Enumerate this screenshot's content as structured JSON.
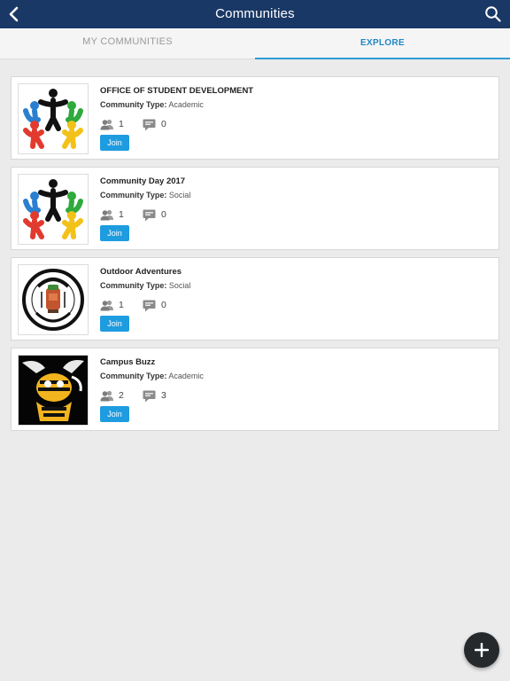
{
  "header": {
    "title": "Communities",
    "back_icon": "chevron-left-icon",
    "search_icon": "search-icon",
    "background": "#1a3866"
  },
  "tabs": [
    {
      "label": "MY COMMUNITIES",
      "active": false
    },
    {
      "label": "EXPLORE",
      "active": true
    }
  ],
  "type_label": "Community Type:",
  "communities": [
    {
      "title": "OFFICE OF STUDENT DEVELOPMENT",
      "type": "Academic",
      "members": "1",
      "posts": "0",
      "join_label": "Join",
      "logo": "people-circle-logo"
    },
    {
      "title": "Community Day 2017",
      "type": "Social",
      "members": "1",
      "posts": "0",
      "join_label": "Join",
      "logo": "people-circle-logo"
    },
    {
      "title": "Outdoor Adventures",
      "type": "Social",
      "members": "1",
      "posts": "0",
      "join_label": "Join",
      "logo": "adventure-club-logo"
    },
    {
      "title": "Campus Buzz",
      "type": "Academic",
      "members": "2",
      "posts": "3",
      "join_label": "Join",
      "logo": "yellow-jacket-logo"
    }
  ],
  "fab": {
    "icon": "plus-icon"
  },
  "colors": {
    "accent": "#1e9ce0",
    "tab_active": "#2187c6"
  }
}
